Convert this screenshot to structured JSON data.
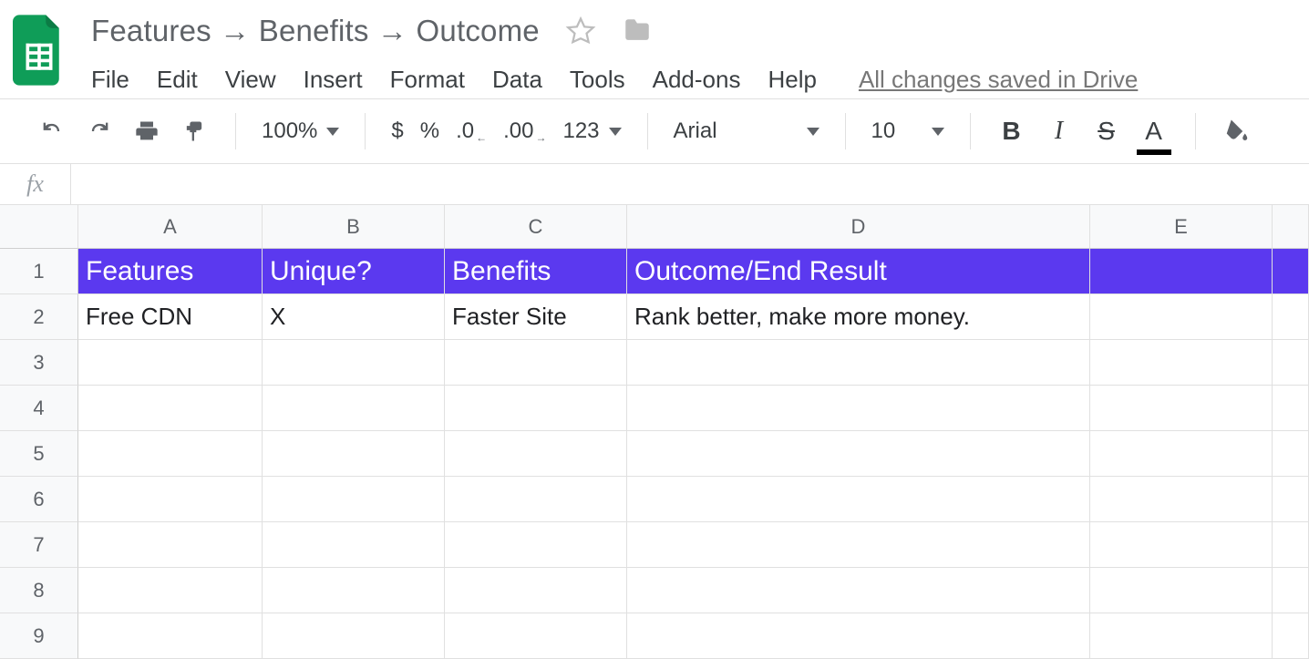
{
  "doc": {
    "title": "Features → Benefits → Outcome",
    "save_status": "All changes saved in Drive"
  },
  "menu": {
    "file": "File",
    "edit": "Edit",
    "view": "View",
    "insert": "Insert",
    "format": "Format",
    "data": "Data",
    "tools": "Tools",
    "addons": "Add-ons",
    "help": "Help"
  },
  "toolbar": {
    "zoom": "100%",
    "currency": "$",
    "percent": "%",
    "dec_less": ".0",
    "dec_more": ".00",
    "numfmt": "123",
    "font": "Arial",
    "fontsize": "10",
    "bold": "B",
    "italic": "I",
    "strike": "S",
    "textcolor": "A"
  },
  "fx": {
    "label": "fx",
    "value": ""
  },
  "columns": [
    "A",
    "B",
    "C",
    "D",
    "E"
  ],
  "row_numbers": [
    "1",
    "2",
    "3",
    "4",
    "5",
    "6",
    "7",
    "8",
    "9"
  ],
  "sheet": {
    "header": {
      "A": "Features",
      "B": "Unique?",
      "C": "Benefits",
      "D": "Outcome/End Result",
      "E": ""
    },
    "rows": [
      {
        "A": "Free CDN",
        "B": "X",
        "C": "Faster Site",
        "D": "Rank better, make more money.",
        "E": ""
      },
      {
        "A": "",
        "B": "",
        "C": "",
        "D": "",
        "E": ""
      },
      {
        "A": "",
        "B": "",
        "C": "",
        "D": "",
        "E": ""
      },
      {
        "A": "",
        "B": "",
        "C": "",
        "D": "",
        "E": ""
      },
      {
        "A": "",
        "B": "",
        "C": "",
        "D": "",
        "E": ""
      },
      {
        "A": "",
        "B": "",
        "C": "",
        "D": "",
        "E": ""
      },
      {
        "A": "",
        "B": "",
        "C": "",
        "D": "",
        "E": ""
      },
      {
        "A": "",
        "B": "",
        "C": "",
        "D": "",
        "E": ""
      }
    ]
  }
}
